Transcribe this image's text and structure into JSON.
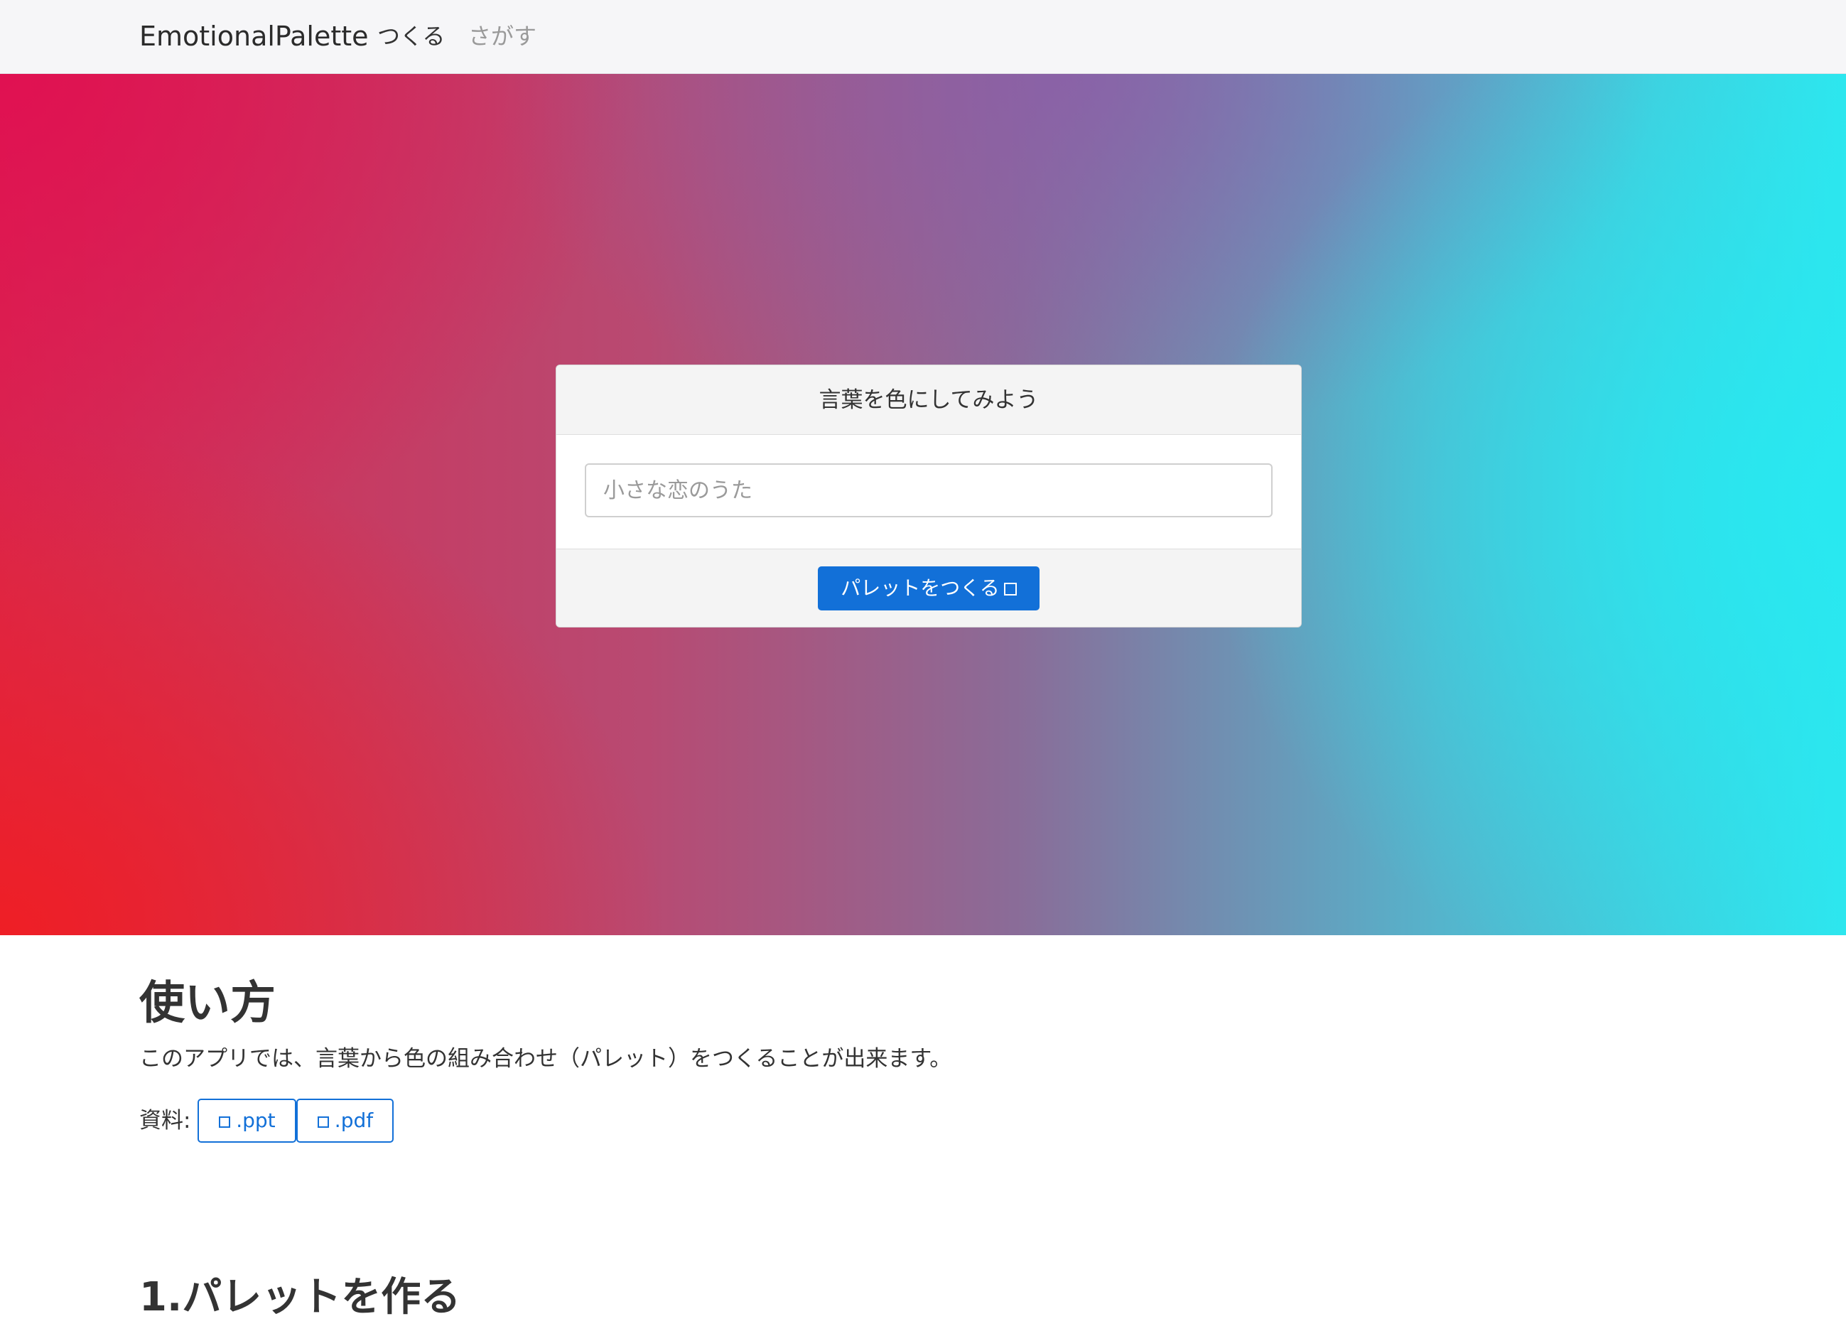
{
  "navbar": {
    "brand": "EmotionalPalette",
    "links": [
      {
        "label": "つくる",
        "active": true
      },
      {
        "label": "さがす",
        "active": false
      }
    ]
  },
  "hero": {
    "colors": {
      "top_left": "#e10e52",
      "bottom_left": "#f01e23",
      "right": "#28e8f0",
      "top_middle": "#8c5caa"
    },
    "card": {
      "header": "言葉を色にしてみよう",
      "input_placeholder": "小さな恋のうた",
      "input_value": "",
      "submit_label": "パレットをつくる",
      "submit_icon": "box-icon"
    }
  },
  "usage": {
    "title": "使い方",
    "description": "このアプリでは、言葉から色の組み合わせ（パレット）をつくることが出来ます。",
    "materials_label": "資料:",
    "materials": [
      {
        "label": ".ppt",
        "icon": "box-icon"
      },
      {
        "label": ".pdf",
        "icon": "box-icon"
      }
    ]
  },
  "section1": {
    "title": "1.パレットを作る"
  },
  "theme": {
    "accent": "#1270d8",
    "navbar_bg": "#f6f6f8",
    "text": "#333333",
    "muted": "#9a9a9a"
  }
}
